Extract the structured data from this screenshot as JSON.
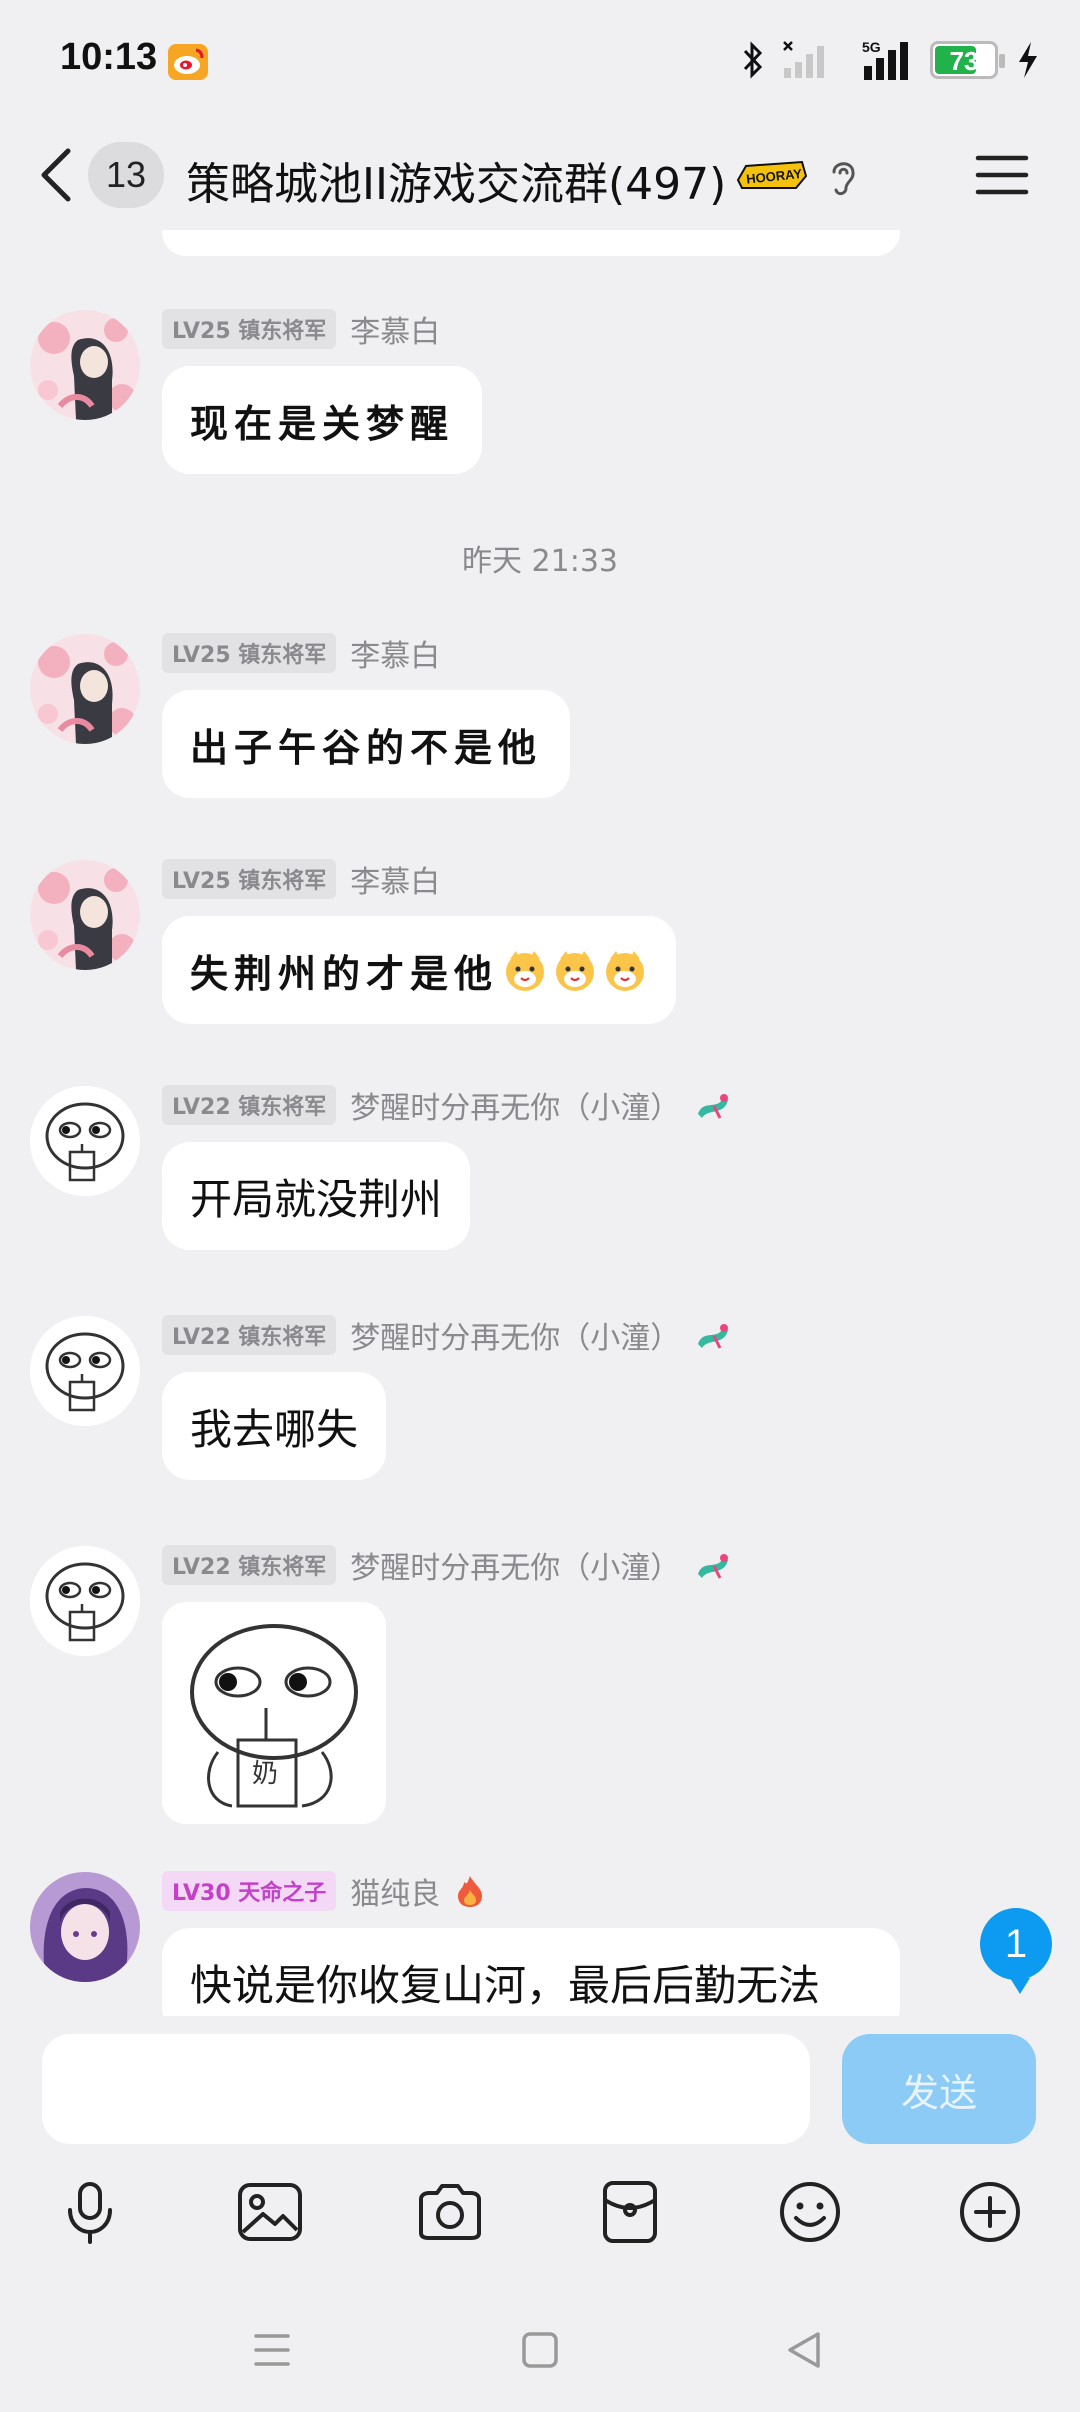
{
  "status_bar": {
    "time": "10:13",
    "battery": "73",
    "battery_level": 0.73,
    "network": "5G"
  },
  "header": {
    "unread_count": "13",
    "title": "策略城池II游戏交流群(497)"
  },
  "messages": [
    {
      "level": "LV25 镇东将军",
      "name": "李慕白",
      "text": "现在是关梦醒"
    },
    {
      "level": "LV25 镇东将军",
      "name": "李慕白",
      "text": "出子午谷的不是他"
    },
    {
      "level": "LV25 镇东将军",
      "name": "李慕白",
      "text": "失荆州的才是他"
    },
    {
      "level": "LV22 镇东将军",
      "name": "梦醒时分再无你（小潼）",
      "text": "开局就没荆州"
    },
    {
      "level": "LV22 镇东将军",
      "name": "梦醒时分再无你（小潼）",
      "text": "我去哪失"
    },
    {
      "level": "LV22 镇东将军",
      "name": "梦醒时分再无你（小潼）",
      "sticker": "奶"
    },
    {
      "level": "LV30 天命之子",
      "name": "猫纯良",
      "text": "快说是你收复山河，最后后勤无法"
    }
  ],
  "time_divider": "昨天 21:33",
  "new_message_badge": "1",
  "input": {
    "value": "",
    "send_label": "发送"
  },
  "toolbar": [
    "mic-icon",
    "image-icon",
    "camera-icon",
    "red-packet-icon",
    "emoji-icon",
    "plus-icon"
  ],
  "colors": {
    "accent": "#0d9bf2",
    "send_disabled": "#8ccbf5",
    "battery": "#22b24c",
    "level_purple": "#c440c8"
  }
}
